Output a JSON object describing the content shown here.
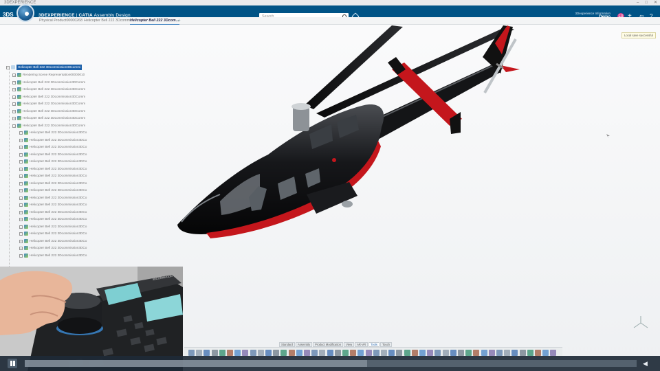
{
  "window": {
    "title": "3DEXPERIENCE"
  },
  "header": {
    "logo": "3DS",
    "brand": "3DEXPERIENCE",
    "separator": " | ",
    "product": "CATIA",
    "app": "Assembly Design",
    "search_placeholder": "Search",
    "user_line": "3Dexperience Information",
    "user_name": "Demo",
    "avatar_initials": "ER",
    "icons": [
      "compass-icon",
      "search-icon",
      "tag-icon",
      "add-icon",
      "share-icon",
      "help-icon"
    ]
  },
  "tabs": [
    {
      "label": "Physical Product00000268",
      "active": false
    },
    {
      "label": "Helicopter Bell 222 3Dcomm…",
      "active": false
    },
    {
      "label": "Helicopter Bell 222 3Dcom…",
      "active": true
    }
  ],
  "tab_add": "+",
  "notification": "Local save successful",
  "tree": {
    "root": "Helicopter Bell 222 3Dcommission3Dcommi",
    "rows": [
      {
        "label": "Rendering Scene Representation00000010",
        "level": 1
      },
      {
        "label": "Helicopter Bell 222 3Dcommission3DComm",
        "level": 1
      },
      {
        "label": "Helicopter Bell 222 3Dcommission3DComm",
        "level": 1
      },
      {
        "label": "Helicopter Bell 222 3Dcommission3DComm",
        "level": 1
      },
      {
        "label": "Helicopter Bell 222 3Dcommission3DComm",
        "level": 1
      },
      {
        "label": "Helicopter Bell 222 3Dcommission3DComm",
        "level": 1
      },
      {
        "label": "Helicopter Bell 222 3Dcommission3DComm",
        "level": 1
      },
      {
        "label": "Helicopter Bell 222 3Dcommission3DComm",
        "level": 1
      },
      {
        "label": "Helicopter Bell 222 3Dcommission3DCo",
        "level": 2
      },
      {
        "label": "Helicopter Bell 222 3Dcommission3DCo",
        "level": 2
      },
      {
        "label": "Helicopter Bell 222 3Dcommission3DCo",
        "level": 2
      },
      {
        "label": "Helicopter Bell 222 3Dcommission3DCo",
        "level": 2
      },
      {
        "label": "Helicopter Bell 222 3Dcommission3DCo",
        "level": 2
      },
      {
        "label": "Helicopter Bell 222 3Dcommission3DCo",
        "level": 2
      },
      {
        "label": "Helicopter Bell 222 3Dcommission3DCo",
        "level": 2
      },
      {
        "label": "Helicopter Bell 222 3Dcommission3DCo",
        "level": 2
      },
      {
        "label": "Helicopter Bell 222 3Dcommission3DCo",
        "level": 2
      },
      {
        "label": "Helicopter Bell 222 3Dcommission3DCo",
        "level": 2
      },
      {
        "label": "Helicopter Bell 222 3Dcommission3DCo",
        "level": 2
      },
      {
        "label": "Helicopter Bell 222 3Dcommission3DCo",
        "level": 2
      },
      {
        "label": "Helicopter Bell 222 3Dcommission3DCo",
        "level": 2
      },
      {
        "label": "Helicopter Bell 222 3Dcommission3DCo",
        "level": 2
      },
      {
        "label": "Helicopter Bell 222 3Dcommission3DCo",
        "level": 2
      },
      {
        "label": "Helicopter Bell 222 3Dcommission3DCo",
        "level": 2
      },
      {
        "label": "Helicopter Bell 222 3Dcommission3DCo",
        "level": 2
      },
      {
        "label": "Helicopter Bell 222 3Dcommission3DCo",
        "level": 2
      }
    ]
  },
  "action_tabs": [
    "Standard",
    "Assembly",
    "Product Modification",
    "View",
    "AR-VR",
    "Tools",
    "Touch"
  ],
  "active_action_tab": "Tools",
  "action_bar_icon_count": 48,
  "device_brand": "3DCONNEXION",
  "player": {
    "progress": 0.56,
    "volume_icon": "volume-icon"
  },
  "colors": {
    "header_bg": "#005386",
    "accent": "#1b5fa8",
    "heli_body": "#111111",
    "heli_stripe": "#c4161c"
  }
}
